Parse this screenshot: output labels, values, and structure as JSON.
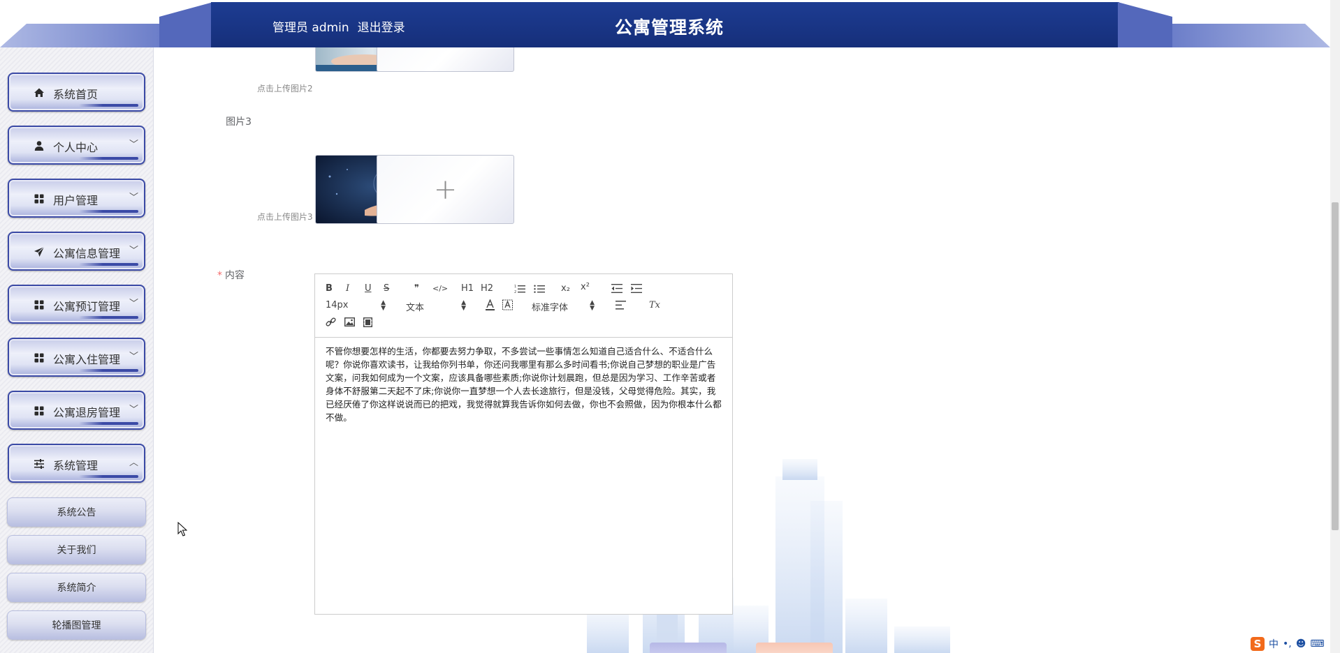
{
  "header": {
    "user_label": "管理员 admin",
    "logout_label": "退出登录",
    "title": "公寓管理系统"
  },
  "sidebar": {
    "items": [
      {
        "label": "系统首页",
        "icon": "home-icon",
        "has_chevron": false
      },
      {
        "label": "个人中心",
        "icon": "user-icon",
        "has_chevron": true,
        "chevron": "﹀"
      },
      {
        "label": "用户管理",
        "icon": "grid-icon",
        "has_chevron": true,
        "chevron": "﹀"
      },
      {
        "label": "公寓信息管理",
        "icon": "send-icon",
        "has_chevron": true,
        "chevron": "﹀"
      },
      {
        "label": "公寓预订管理",
        "icon": "grid-icon",
        "has_chevron": true,
        "chevron": "﹀"
      },
      {
        "label": "公寓入住管理",
        "icon": "grid-icon",
        "has_chevron": true,
        "chevron": "﹀"
      },
      {
        "label": "公寓退房管理",
        "icon": "grid-icon",
        "has_chevron": true,
        "chevron": "﹀"
      },
      {
        "label": "系统管理",
        "icon": "sliders-icon",
        "has_chevron": true,
        "chevron": "︿",
        "expanded": true
      }
    ],
    "sub_items": [
      "系统公告",
      "关于我们",
      "系统简介",
      "轮播图管理"
    ]
  },
  "form": {
    "hint2": "点击上传图片2",
    "label3": "图片3",
    "hint3": "点击上传图片3",
    "content_label": "内容",
    "required_mark": "*",
    "plus": "+"
  },
  "editor": {
    "toolbar": {
      "bold": "B",
      "italic": "I",
      "underline": "U",
      "strike": "S",
      "quote": "❞",
      "code": "</>",
      "h1": "H1",
      "h2": "H2",
      "sub": "x₂",
      "sup": "x²",
      "size_value": "14px",
      "header_value": "文本",
      "font_value": "标准字体",
      "clean": "Tx"
    },
    "text": "不管你想要怎样的生活，你都要去努力争取，不多尝试一些事情怎么知道自己适合什么、不适合什么呢？你说你喜欢读书，让我给你列书单，你还问我哪里有那么多时间看书;你说自己梦想的职业是广告文案，问我如何成为一个文案，应该具备哪些素质;你说你计划晨跑，但总是因为学习、工作辛苦或者身体不舒服第二天起不了床;你说你一直梦想一个人去长途旅行，但是没钱，父母觉得危险。其实，我已经厌倦了你这样说说而已的把戏，我觉得就算我告诉你如何去做，你也不会照做，因为你根本什么都不做。"
  },
  "ime": {
    "lang": "中",
    "punct": "•,"
  },
  "colors": {
    "brand": "#1f3a8f",
    "accent": "#3b4aa6"
  }
}
